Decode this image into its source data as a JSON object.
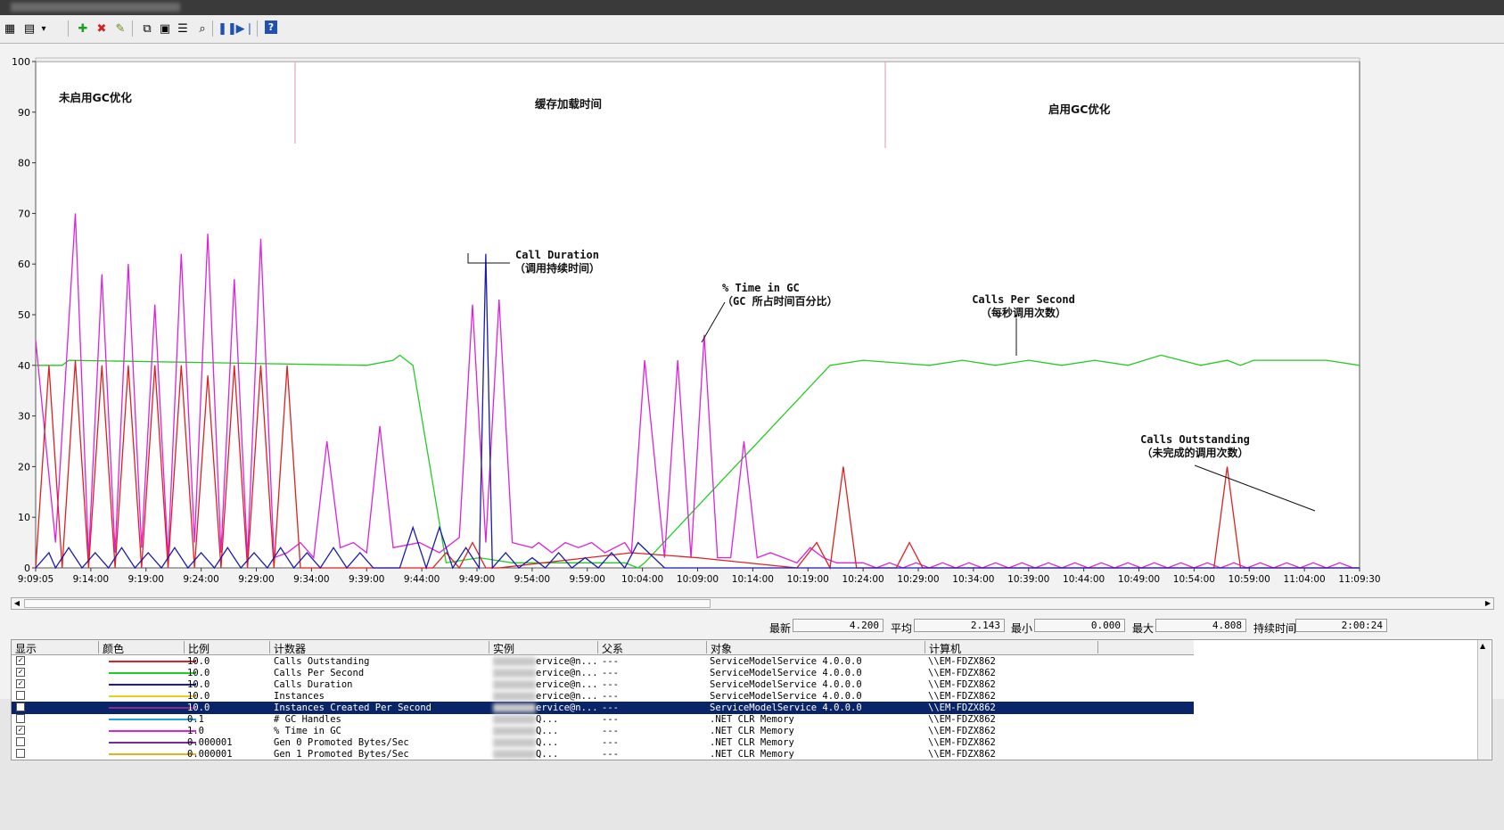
{
  "window": {
    "title": ""
  },
  "toolbar": {
    "buttons": [
      {
        "icon": "view-current-activity-icon",
        "glyph": "▦"
      },
      {
        "icon": "change-graph-type-icon",
        "glyph": "▤"
      },
      {
        "icon": "graph-type-dropdown-icon",
        "glyph": "▾"
      },
      {
        "icon": "add-counter-icon",
        "glyph": "✚",
        "color": "#1aa01a"
      },
      {
        "icon": "delete-counter-icon",
        "glyph": "✖",
        "color": "#d42020"
      },
      {
        "icon": "highlight-icon",
        "glyph": "✎",
        "color": "#6a8a1a"
      },
      {
        "icon": "copy-properties-icon",
        "glyph": "⧉"
      },
      {
        "icon": "paste-counter-list-icon",
        "glyph": "▣"
      },
      {
        "icon": "properties-icon",
        "glyph": "☰"
      },
      {
        "icon": "zoom-icon",
        "glyph": "⌕"
      },
      {
        "icon": "freeze-display-icon",
        "glyph": "❚❚",
        "color": "#2050b0"
      },
      {
        "icon": "update-data-icon",
        "glyph": "▶❘",
        "color": "#2050b0"
      },
      {
        "icon": "help-icon",
        "glyph": "?",
        "color": "#ffffff",
        "bg": "#2050b0"
      }
    ]
  },
  "chart_data": {
    "type": "line",
    "ylim": [
      0,
      100
    ],
    "yticks": [
      "100",
      "90",
      "80",
      "70",
      "60",
      "50",
      "40",
      "30",
      "20",
      "10",
      "0"
    ],
    "xticks": [
      "9:09:05",
      "9:14:00",
      "9:19:00",
      "9:24:00",
      "9:29:00",
      "9:34:00",
      "9:39:00",
      "9:44:00",
      "9:49:00",
      "9:54:00",
      "9:59:00",
      "10:04:00",
      "10:09:00",
      "10:14:00",
      "10:19:00",
      "10:24:00",
      "10:29:00",
      "10:34:00",
      "10:39:00",
      "10:44:00",
      "10:49:00",
      "10:54:00",
      "10:59:00",
      "11:04:00",
      "11:09:30"
    ],
    "sections": [
      "未启用GC优化",
      "缓存加载时间",
      "启用GC优化"
    ],
    "annotations": [
      {
        "line1": "Call Duration",
        "line2": "（调用持续时间）"
      },
      {
        "line1": "% Time in GC",
        "line2": "（GC 所占时间百分比）"
      },
      {
        "line1": "Calls Per Second",
        "line2": "（每秒调用次数）"
      },
      {
        "line1": "Calls Outstanding",
        "line2": "（未完成的调用次数）"
      }
    ],
    "series": [
      {
        "name": "Calls Per Second",
        "color": "#22cc22",
        "x": [
          0,
          4,
          5,
          50,
          54,
          55,
          57,
          62,
          67,
          72,
          77,
          82,
          87,
          89,
          91,
          92,
          120,
          125,
          135,
          140,
          145,
          150,
          155,
          160,
          165,
          170,
          176,
          180,
          182,
          184,
          195,
          200
        ],
        "y": [
          40,
          40,
          41,
          40,
          41,
          42,
          40,
          1,
          2,
          1,
          1,
          1,
          1,
          1,
          0,
          1,
          40,
          41,
          40,
          41,
          40,
          41,
          40,
          41,
          40,
          42,
          40,
          41,
          40,
          41,
          41,
          40
        ]
      },
      {
        "name": "% Time in GC",
        "color": "#dd22dd",
        "x": [
          0,
          3,
          6,
          8,
          10,
          12,
          14,
          16,
          18,
          20,
          22,
          24,
          26,
          28,
          30,
          32,
          34,
          36,
          38,
          40,
          42,
          44,
          46,
          48,
          50,
          52,
          54,
          58,
          61,
          64,
          66,
          68,
          70,
          72,
          75,
          76,
          78,
          80,
          82,
          84,
          86,
          89,
          90,
          92,
          95,
          97,
          99,
          101,
          103,
          105,
          107,
          109,
          111,
          113,
          115,
          117,
          119,
          121,
          123,
          125,
          127,
          129,
          131,
          133,
          135,
          137,
          139,
          141,
          143,
          145,
          147,
          149,
          151,
          153,
          155,
          157,
          159,
          161,
          163,
          165,
          167,
          169,
          171,
          173,
          175,
          177,
          179,
          181,
          183,
          185,
          187,
          189,
          191,
          193,
          195,
          197,
          199,
          200
        ],
        "y": [
          45,
          5,
          70,
          2,
          58,
          3,
          60,
          4,
          52,
          2,
          62,
          5,
          66,
          3,
          57,
          2,
          65,
          2,
          3,
          5,
          2,
          25,
          4,
          5,
          3,
          28,
          4,
          5,
          3,
          6,
          52,
          5,
          53,
          5,
          4,
          5,
          3,
          5,
          4,
          5,
          3,
          5,
          3,
          41,
          2,
          41,
          2,
          46,
          2,
          2,
          25,
          2,
          3,
          2,
          1,
          4,
          2,
          1,
          1,
          1,
          0,
          1,
          0,
          1,
          0,
          1,
          0,
          1,
          0,
          1,
          0,
          1,
          0,
          1,
          0,
          1,
          0,
          1,
          0,
          1,
          0,
          1,
          0,
          1,
          0,
          1,
          0,
          1,
          0,
          1,
          0,
          1,
          0,
          1,
          0,
          1,
          0,
          0
        ]
      },
      {
        "name": "Calls Outstanding",
        "color": "#e02020",
        "x": [
          0,
          2,
          4,
          6,
          8,
          10,
          12,
          14,
          16,
          18,
          20,
          22,
          24,
          26,
          28,
          30,
          32,
          34,
          36,
          38,
          40,
          60,
          62,
          64,
          66,
          68,
          70,
          90,
          100,
          115,
          118,
          120,
          122,
          124,
          130,
          132,
          134,
          140,
          142,
          144,
          150,
          160,
          170,
          178,
          180,
          182,
          200
        ],
        "y": [
          0,
          40,
          0,
          41,
          0,
          40,
          0,
          40,
          0,
          40,
          0,
          40,
          0,
          38,
          0,
          40,
          0,
          40,
          0,
          40,
          0,
          0,
          3,
          0,
          5,
          0,
          0,
          3,
          2,
          0,
          5,
          0,
          20,
          0,
          0,
          5,
          0,
          0,
          0,
          0,
          0,
          0,
          0,
          0,
          20,
          0,
          0
        ]
      },
      {
        "name": "Calls Duration",
        "color": "#1a1ab0",
        "x": [
          0,
          2,
          3,
          5,
          7,
          9,
          11,
          13,
          15,
          17,
          19,
          21,
          23,
          25,
          27,
          29,
          31,
          33,
          35,
          37,
          39,
          41,
          43,
          45,
          47,
          49,
          51,
          55,
          57,
          59,
          61,
          63,
          65,
          67,
          68,
          69,
          71,
          73,
          75,
          77,
          79,
          81,
          83,
          85,
          87,
          89,
          91,
          95,
          100,
          110,
          120,
          130,
          140,
          150,
          160,
          170,
          180,
          190,
          200
        ],
        "y": [
          0,
          3,
          0,
          4,
          0,
          3,
          0,
          4,
          0,
          3,
          0,
          4,
          0,
          3,
          0,
          4,
          0,
          3,
          0,
          4,
          0,
          3,
          0,
          4,
          0,
          3,
          0,
          0,
          8,
          0,
          8,
          0,
          4,
          0,
          62,
          0,
          3,
          0,
          2,
          0,
          3,
          0,
          2,
          0,
          3,
          0,
          5,
          0,
          0,
          0,
          0,
          0,
          0,
          0,
          0,
          0,
          0,
          0,
          0
        ]
      }
    ]
  },
  "stats": {
    "latest_label": "最新",
    "latest": "4.200",
    "avg_label": "平均",
    "avg": "2.143",
    "min_label": "最小",
    "min": "0.000",
    "max_label": "最大",
    "max": "4.808",
    "duration_label": "持续时间",
    "duration": "2:00:24"
  },
  "legend": {
    "headers": [
      "显示",
      "颜色",
      "比例",
      "计数器",
      "实例",
      "父系",
      "对象",
      "计算机"
    ],
    "rows": [
      {
        "checked": true,
        "color": "#e02020",
        "scale": "10.0",
        "counter": "Calls Outstanding",
        "instance": "ervice@n...",
        "parent": "---",
        "object": "ServiceModelService 4.0.0.0",
        "computer": "\\\\EM-FDZX862"
      },
      {
        "checked": true,
        "color": "#22cc22",
        "scale": "10.0",
        "counter": "Calls Per Second",
        "instance": "ervice@n...",
        "parent": "---",
        "object": "ServiceModelService 4.0.0.0",
        "computer": "\\\\EM-FDZX862"
      },
      {
        "checked": true,
        "color": "#1a1ab0",
        "scale": "10.0",
        "counter": "Calls Duration",
        "instance": "ervice@n...",
        "parent": "---",
        "object": "ServiceModelService 4.0.0.0",
        "computer": "\\\\EM-FDZX862"
      },
      {
        "checked": false,
        "color": "#e8d020",
        "scale": "10.0",
        "counter": "Instances",
        "instance": "ervice@n...",
        "parent": "---",
        "object": "ServiceModelService 4.0.0.0",
        "computer": "\\\\EM-FDZX862"
      },
      {
        "checked": false,
        "color": "#8a2a8a",
        "scale": "10.0",
        "counter": "Instances Created Per Second",
        "instance": "ervice@n...",
        "parent": "---",
        "object": "ServiceModelService 4.0.0.0",
        "computer": "\\\\EM-FDZX862",
        "selected": true
      },
      {
        "checked": false,
        "color": "#20a0e0",
        "scale": "0.1",
        "counter": "# GC Handles",
        "instance": "Q...",
        "parent": "---",
        "object": ".NET CLR Memory",
        "computer": "\\\\EM-FDZX862"
      },
      {
        "checked": true,
        "color": "#dd22dd",
        "scale": "1.0",
        "counter": "% Time in GC",
        "instance": "Q...",
        "parent": "---",
        "object": ".NET CLR Memory",
        "computer": "\\\\EM-FDZX862"
      },
      {
        "checked": false,
        "color": "#7a2a9a",
        "scale": "0.000001",
        "counter": "Gen 0 Promoted Bytes/Sec",
        "instance": "Q...",
        "parent": "---",
        "object": ".NET CLR Memory",
        "computer": "\\\\EM-FDZX862"
      },
      {
        "checked": false,
        "color": "#e8b020",
        "scale": "0.000001",
        "counter": "Gen 1 Promoted Bytes/Sec",
        "instance": "Q...",
        "parent": "---",
        "object": ".NET CLR Memory",
        "computer": "\\\\EM-FDZX862"
      }
    ]
  }
}
